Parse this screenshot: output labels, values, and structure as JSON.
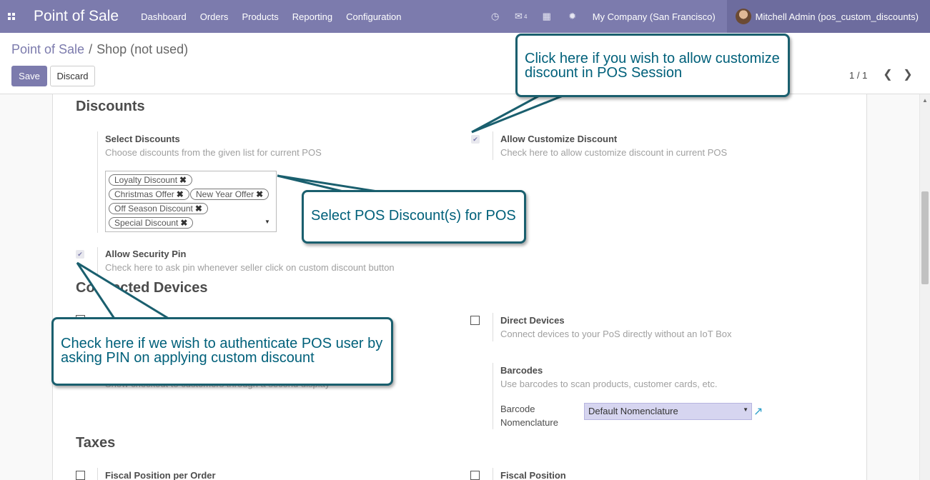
{
  "navbar": {
    "brand": "Point of Sale",
    "menu": [
      "Dashboard",
      "Orders",
      "Products",
      "Reporting",
      "Configuration"
    ],
    "chat_count": "4",
    "company": "My Company (San Francisco)",
    "user": "Mitchell Admin (pos_custom_discounts)"
  },
  "breadcrumb": {
    "parent": "Point of Sale",
    "separator": "/",
    "current": "Shop (not used)"
  },
  "buttons": {
    "save": "Save",
    "discard": "Discard"
  },
  "pager": {
    "value": "1 / 1"
  },
  "discounts": {
    "section_title": "Discounts",
    "select_title": "Select Discounts",
    "select_desc": "Choose discounts from the given list for current POS",
    "tags": [
      "Loyalty Discount",
      "Christmas Offer",
      "New Year Offer",
      "Off Season Discount",
      "Special Discount"
    ],
    "allow_customize_title": "Allow Customize Discount",
    "allow_customize_desc": "Check here to allow customize discount in current POS",
    "allow_pin_title": "Allow Security Pin",
    "allow_pin_desc": "Check here to ask pin whenever seller click on custom discount button"
  },
  "devices": {
    "section_title": "Connected Devices",
    "direct_title": "Direct Devices",
    "direct_desc": "Connect devices to your PoS directly without an IoT Box",
    "barcodes_title": "Barcodes",
    "barcodes_desc": "Use barcodes to scan products, customer cards, etc.",
    "nomenclature_label_1": "Barcode",
    "nomenclature_label_2": "Nomenclature",
    "nomenclature_value": "Default Nomenclature",
    "customer_display_desc": "Show checkout to customers through a second display"
  },
  "taxes": {
    "section_title": "Taxes",
    "fiscal_per_order": "Fiscal Position per Order",
    "fiscal_position": "Fiscal Position"
  },
  "callouts": {
    "customize": "Click here if you wish to allow customize discount in POS Session",
    "select": "Select POS Discount(s) for POS",
    "pin": "Check here if we wish to authenticate POS user by asking PIN on applying custom discount"
  }
}
